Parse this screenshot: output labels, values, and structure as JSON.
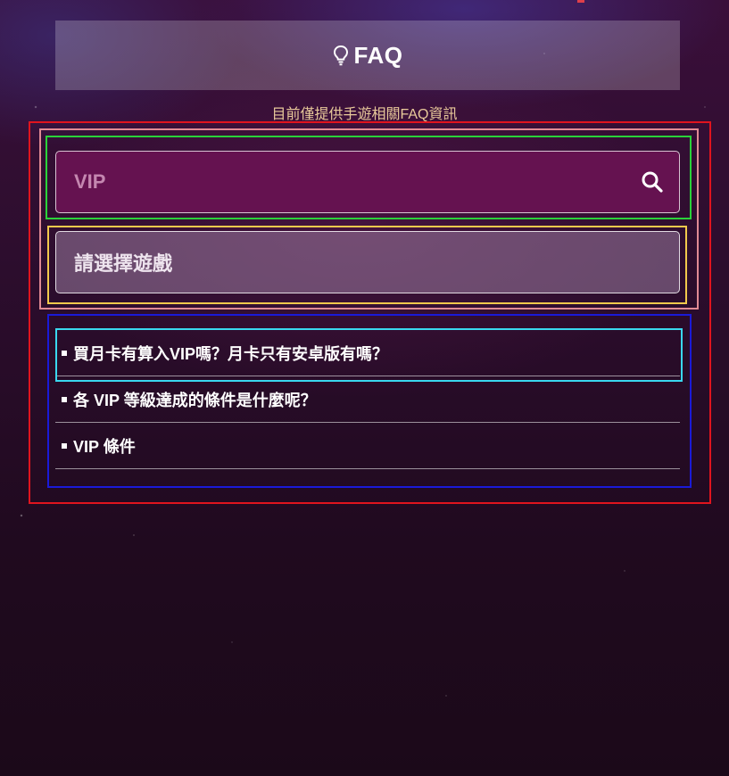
{
  "header": {
    "title": "FAQ",
    "icon": "lightbulb-icon"
  },
  "notice": "目前僅提供手遊相關FAQ資訊",
  "search": {
    "value": "VIP",
    "placeholder": "VIP",
    "icon": "search-icon"
  },
  "game_select": {
    "label": "請選擇遊戲"
  },
  "faq_items": [
    {
      "text": "買月卡有算入VIP嗎？月卡只有安卓版有嗎？"
    },
    {
      "text": "各 VIP 等級達成的條件是什麼呢？"
    },
    {
      "text": "VIP 條件"
    }
  ],
  "colors": {
    "notice_text": "#e8c99a",
    "search_bg": "#651250",
    "search_text": "#c487b0",
    "highlight_red": "#e0141e",
    "highlight_pink": "#e08a94",
    "highlight_green": "#2ad23a",
    "highlight_yellow": "#f2c94c",
    "highlight_blue": "#1a1ad8",
    "highlight_cyan": "#3ad8ef"
  }
}
